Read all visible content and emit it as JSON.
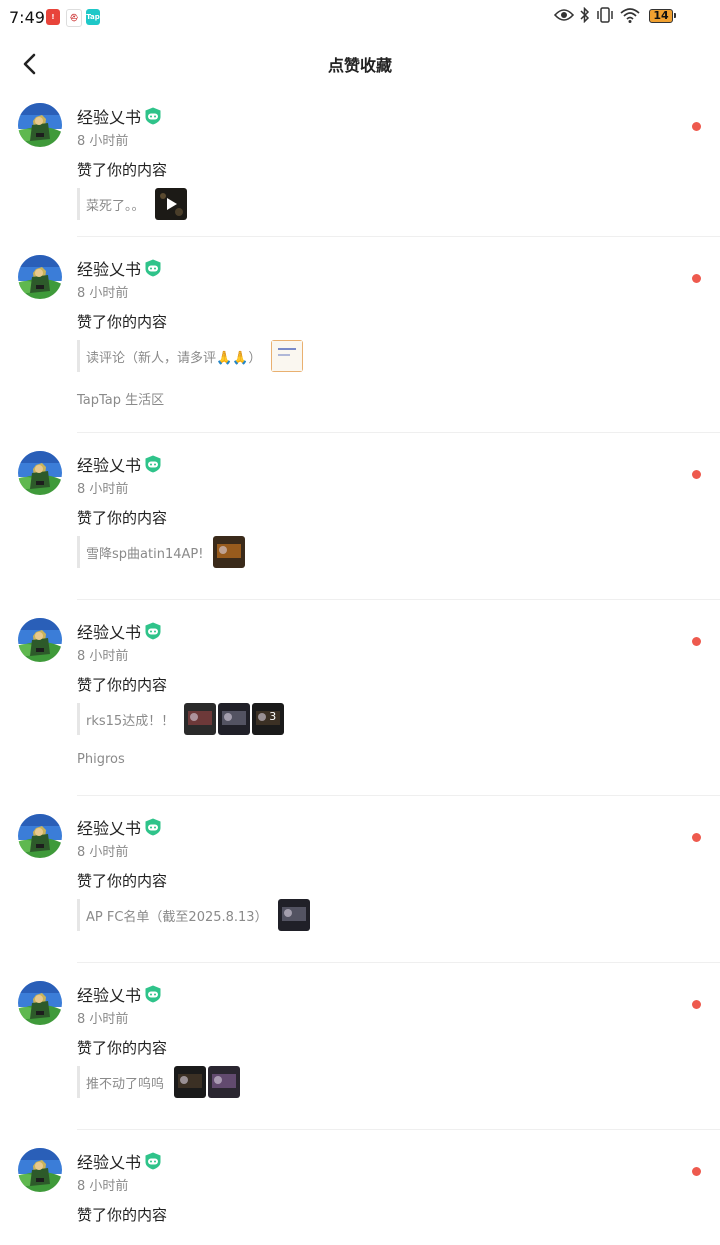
{
  "status_bar": {
    "time": "7:49",
    "battery": "14",
    "app_icons": [
      "warning-app-icon",
      "game-app-icon",
      "taptap-app-icon"
    ],
    "indicators": [
      "eye-icon",
      "bluetooth-icon",
      "vibrate-icon",
      "wifi-icon"
    ]
  },
  "header": {
    "title": "点赞收藏"
  },
  "colors": {
    "accent_dot": "#ee5a4e",
    "badge_green": "#2fc38a"
  },
  "notifications": [
    {
      "user": "经验乂书",
      "time": "8 小时前",
      "action": "赞了你的内容",
      "snippet": "菜死了。。",
      "thumbs": 1,
      "thumb_types": [
        "video"
      ],
      "community": ""
    },
    {
      "user": "经验乂书",
      "time": "8 小时前",
      "action": "赞了你的内容",
      "snippet": "读评论（新人，请多评🙏🙏）",
      "thumbs": 1,
      "thumb_types": [
        "doc"
      ],
      "community": "TapTap 生活区"
    },
    {
      "user": "经验乂书",
      "time": "8 小时前",
      "action": "赞了你的内容",
      "snippet": "雪降sp曲atin14AP!",
      "thumbs": 1,
      "thumb_types": [
        "image"
      ],
      "community": ""
    },
    {
      "user": "经验乂书",
      "time": "8 小时前",
      "action": "赞了你的内容",
      "snippet": "rks15达成！！",
      "thumbs": 3,
      "thumb_types": [
        "image",
        "image",
        "image"
      ],
      "more_count": "3",
      "community": "Phigros"
    },
    {
      "user": "经验乂书",
      "time": "8 小时前",
      "action": "赞了你的内容",
      "snippet": "AP FC名单（截至2025.8.13）",
      "thumbs": 1,
      "thumb_types": [
        "image"
      ],
      "community": ""
    },
    {
      "user": "经验乂书",
      "time": "8 小时前",
      "action": "赞了你的内容",
      "snippet": "推不动了呜呜",
      "thumbs": 2,
      "thumb_types": [
        "image",
        "image"
      ],
      "community": ""
    },
    {
      "user": "经验乂书",
      "time": "8 小时前",
      "action": "赞了你的内容",
      "snippet": "",
      "thumbs": 0,
      "thumb_types": [],
      "community": ""
    }
  ]
}
